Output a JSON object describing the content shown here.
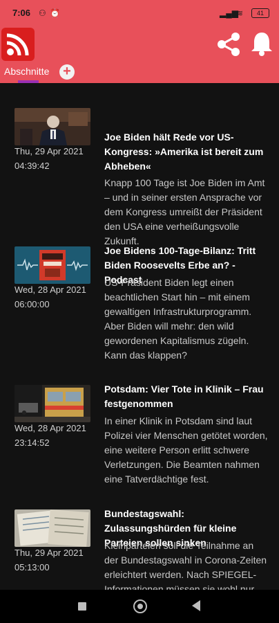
{
  "status_bar": {
    "time": "7:06",
    "battery": "41"
  },
  "header": {
    "tab_label": "Abschnitte"
  },
  "articles": [
    {
      "date": "Thu, 29 Apr 2021",
      "time": "04:39:42",
      "title": "Joe Biden hält Rede vor US-Kongress: »Amerika ist bereit zum Abheben«",
      "description": "Knapp 100 Tage ist Joe Biden im Amt – und in seiner ersten Ansprache vor dem Kongress umreißt der Präsident den USA eine verheißungsvolle Zukunft."
    },
    {
      "date": "Wed, 28 Apr 2021",
      "time": "06:00:00",
      "title": "Joe Bidens 100-Tage-Bilanz: Tritt Biden Roosevelts Erbe an? - Podcast",
      "description": "US-Präsident Biden legt einen beachtlichen Start hin – mit einem gewaltigen Infrastrukturprogramm. Aber Biden will mehr: den wild gewordenen Kapitalismus zügeln. Kann das klappen?"
    },
    {
      "date": "Wed, 28 Apr 2021",
      "time": "23:14:52",
      "title": "Potsdam: Vier Tote in Klinik – Frau festgenommen",
      "description": "In einer Klinik in Potsdam sind laut Polizei vier Menschen getötet worden, eine weitere Person erlitt schwere Verletzungen. Die Beamten nahmen eine Tatverdächtige fest."
    },
    {
      "date": "Thu, 29 Apr 2021",
      "time": "05:13:00",
      "title": "Bundestagswahl: Zulassungshürden für kleine Parteien sollen sinken",
      "description": "Kleinparteien soll die Teilnahme an der Bundestagswahl in Corona-Zeiten erleichtert werden. Nach SPIEGEL-Informationen müssen sie wohl nur"
    }
  ]
}
